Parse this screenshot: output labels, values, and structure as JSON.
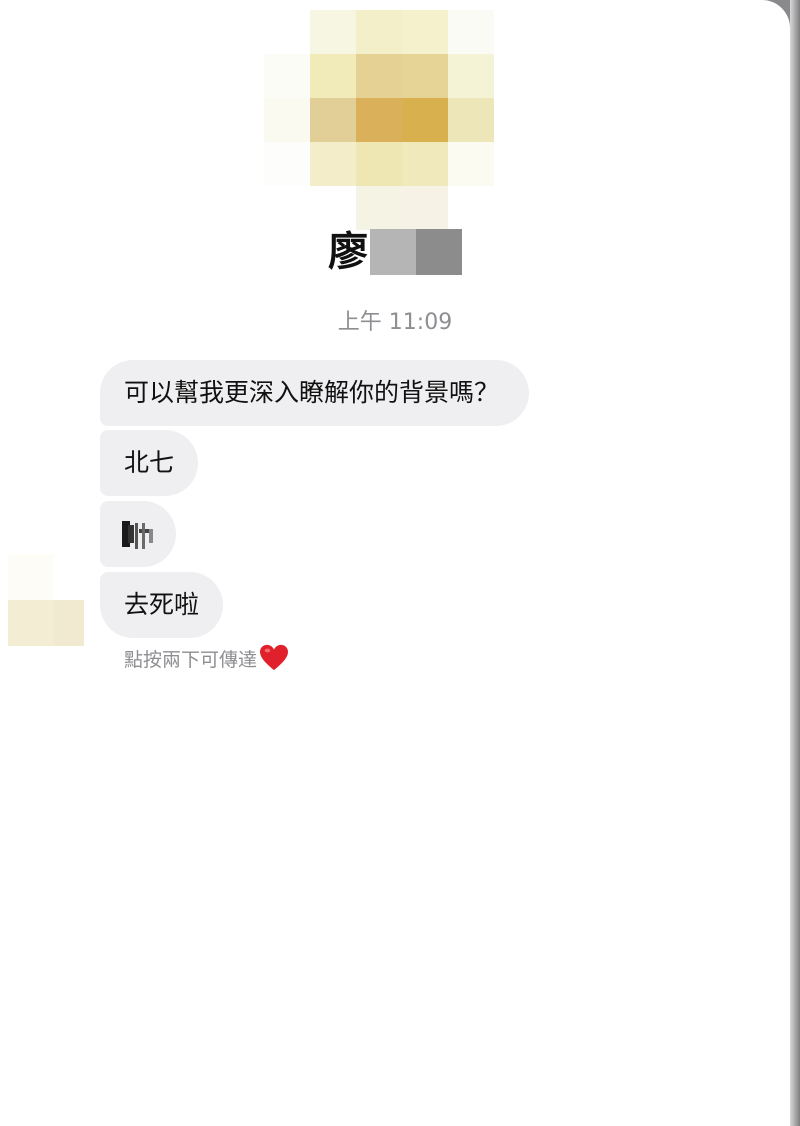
{
  "chat": {
    "contact_name": "廖",
    "timestamp": "上午 11:09",
    "messages": [
      {
        "text": "可以幫我更深入瞭解你的背景嗎？"
      },
      {
        "text": "北七"
      },
      {
        "text": ""
      },
      {
        "text": "去死啦"
      }
    ],
    "reaction_hint": "點按兩下可傳達"
  },
  "icons": {
    "reaction": "heart-icon",
    "profile": "avatar-pixelated",
    "sender": "sender-avatar-pixelated"
  },
  "colors": {
    "bubble_bg": "#efeff1",
    "heart": "#e0202b",
    "avatar_gold": "#d9b04e"
  }
}
